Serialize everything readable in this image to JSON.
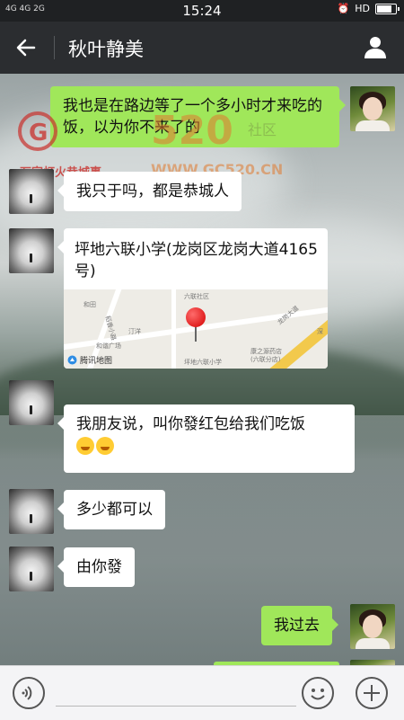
{
  "status_bar": {
    "signal": "4G 4G 2G",
    "time": "15:24",
    "hd": "HD"
  },
  "header": {
    "title": "秋叶静美"
  },
  "watermark": {
    "brand": "520",
    "sub": "社区",
    "slogan": "万家灯火恭城事",
    "url": "WWW.GC520.CN"
  },
  "messages": [
    {
      "side": "out",
      "text": "我也是在路边等了一个多小时才来吃的饭，以为你不来了的"
    },
    {
      "side": "in",
      "text": "我只于吗，都是恭城人"
    },
    {
      "side": "in",
      "type": "location",
      "text": "坪地六联小学(龙岗区龙岗大道4165号)"
    },
    {
      "side": "in",
      "text": "我朋友说，叫你發红包给我们吃饭"
    },
    {
      "side": "in",
      "text": "多少都可以"
    },
    {
      "side": "in",
      "text": "由你發"
    },
    {
      "side": "out",
      "text": "我过去"
    }
  ],
  "map": {
    "provider": "腾讯地图",
    "labels": [
      "六联社区",
      "坪地六联小学",
      "龙岗大道",
      "汀洋",
      "和田",
      "稻香小路",
      "和谐广场",
      "康之源药店",
      "(六联分店)",
      "深"
    ]
  },
  "colors": {
    "header_bg": "#2b2d30",
    "out_bubble": "#a0e75a",
    "in_bubble": "#ffffff"
  },
  "icons": [
    "back-arrow-icon",
    "profile-icon",
    "voice-icon",
    "emoji-icon",
    "plus-icon"
  ]
}
